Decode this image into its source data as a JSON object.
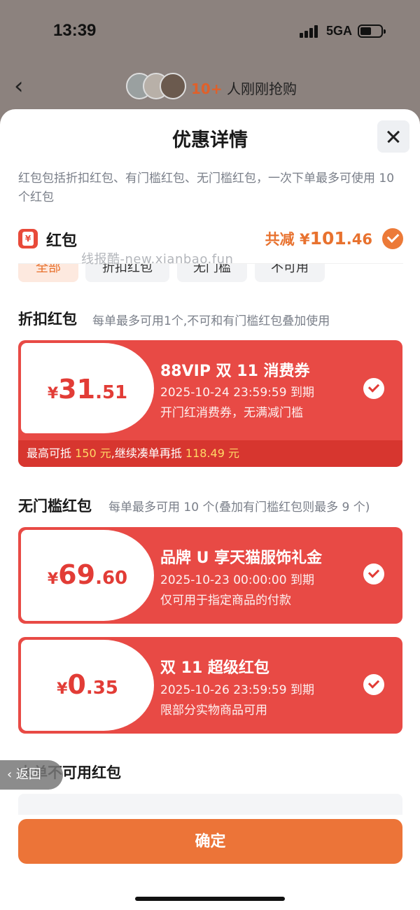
{
  "status_bar": {
    "time": "13:39",
    "network": "5GA"
  },
  "header": {
    "buyers_count": "10+",
    "buyers_text": "人刚刚抢购"
  },
  "sheet": {
    "title": "优惠详情",
    "description": "红包包括折扣红包、有门槛红包、无门槛红包，一次下单最多可使用 10 个红包",
    "redpacket_label": "红包",
    "total_prefix": "共减 ¥",
    "total_int": "101",
    "total_dec": ".46",
    "watermark": "线报酷-new.xianbao.fun",
    "tabs": [
      "全部",
      "折扣红包",
      "无门槛",
      "不可用"
    ],
    "discount_section": {
      "title": "折扣红包",
      "note": "每单最多可用1个,不可和有门槛红包叠加使用"
    },
    "no_threshold_section": {
      "title": "无门槛红包",
      "note": "每单最多可用 10 个(叠加有门槛红包则最多 9 个)"
    },
    "unavailable_title": "本单不可用红包",
    "back_label": "返回",
    "confirm_label": "确定"
  },
  "coupons": [
    {
      "currency": "¥",
      "int": "31",
      "dec": ".51",
      "name": "88VIP 双 11 消费券",
      "expire": "2025-10-24 23:59:59 到期",
      "rule": "开门红消费券，无满减门槛",
      "footer": {
        "p1": "最高可抵 ",
        "v1": "150 元",
        "p2": ",继续凑单再抵 ",
        "v2": "118.49 元"
      }
    },
    {
      "currency": "¥",
      "int": "69",
      "dec": ".60",
      "name": "品牌 U 享天猫服饰礼金",
      "expire": "2025-10-23 00:00:00 到期",
      "rule": "仅可用于指定商品的付款"
    },
    {
      "currency": "¥",
      "int": "0",
      "dec": ".35",
      "name": "双 11 超级红包",
      "expire": "2025-10-26 23:59:59 到期",
      "rule": "限部分实物商品可用"
    }
  ],
  "colors": {
    "accent": "#ec7438",
    "coupon": "#e84a45",
    "coupon_footer": "#d7362f",
    "highlight": "#ffd966"
  }
}
